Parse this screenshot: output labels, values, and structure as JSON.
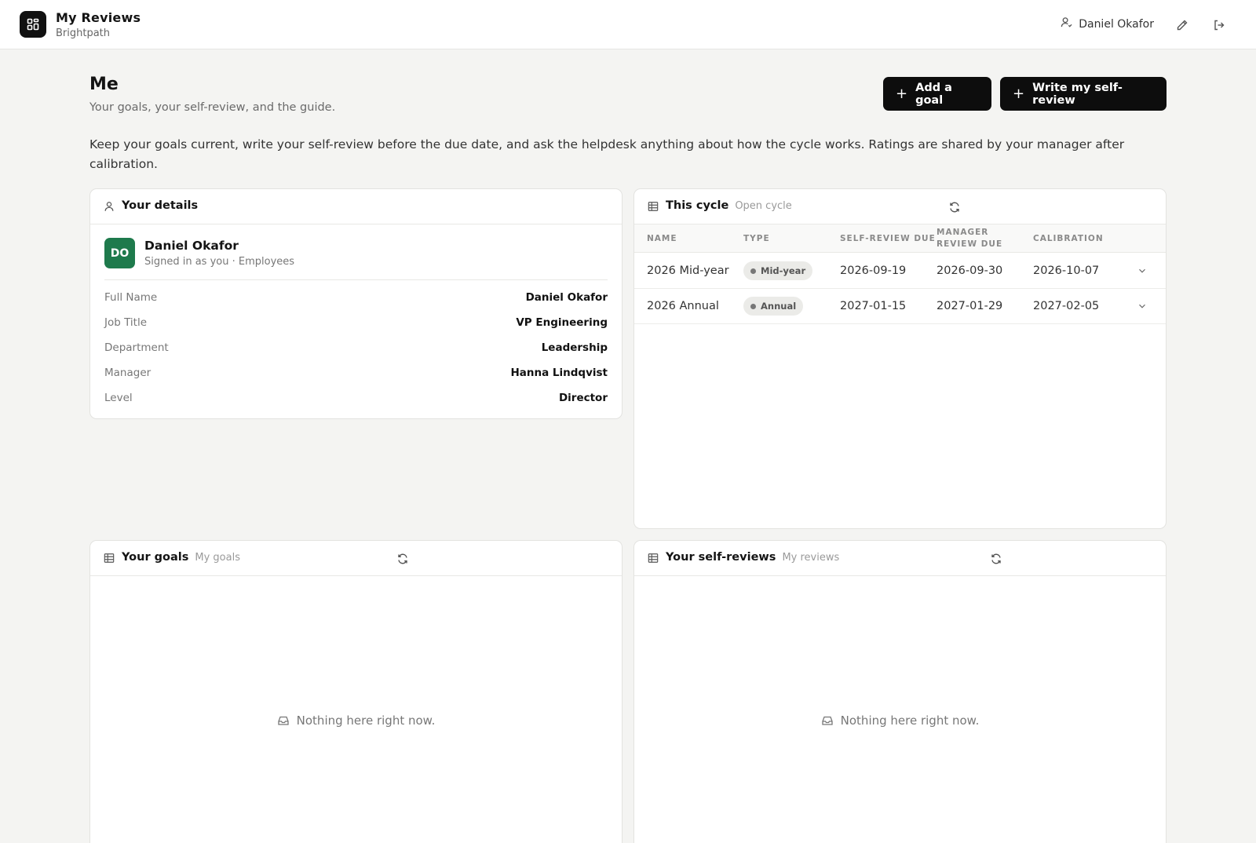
{
  "app": {
    "title": "My Reviews",
    "subtitle": "Brightpath"
  },
  "user": {
    "name": "Daniel Okafor"
  },
  "header": {
    "title": "Me",
    "subtitle": "Your goals, your self-review, and the guide.",
    "add_goal_label": "Add a goal",
    "self_review_label": "Write my self-review",
    "intro": "Keep your goals current, write your self-review before the due date, and ask the helpdesk anything about how the cycle works. Ratings are shared by your manager after calibration."
  },
  "details": {
    "title": "Your details",
    "initials": "DO",
    "name": "Daniel Okafor",
    "meta": "Signed in as you · Employees",
    "fields": [
      {
        "label": "Full Name",
        "value": "Daniel Okafor"
      },
      {
        "label": "Job Title",
        "value": "VP Engineering"
      },
      {
        "label": "Department",
        "value": "Leadership"
      },
      {
        "label": "Manager",
        "value": "Hanna Lindqvist"
      },
      {
        "label": "Level",
        "value": "Director"
      }
    ]
  },
  "cycle": {
    "title": "This cycle",
    "tag": "Open cycle",
    "columns": [
      "NAME",
      "TYPE",
      "SELF-REVIEW DUE",
      "MANAGER REVIEW DUE",
      "CALIBRATION"
    ],
    "rows": [
      {
        "name": "2026 Mid-year",
        "type": "Mid-year",
        "self_due": "2026-09-19",
        "manager_due": "2026-09-30",
        "calibration": "2026-10-07"
      },
      {
        "name": "2026 Annual",
        "type": "Annual",
        "self_due": "2027-01-15",
        "manager_due": "2027-01-29",
        "calibration": "2027-02-05"
      }
    ]
  },
  "goals": {
    "title": "Your goals",
    "tag": "My goals",
    "empty": "Nothing here right now."
  },
  "reviews": {
    "title": "Your self-reviews",
    "tag": "My reviews",
    "empty": "Nothing here right now."
  },
  "icons": {
    "logo": "grid-icon",
    "user": "user-icon",
    "edit": "pencil-icon",
    "logout": "logout-icon",
    "table": "table-icon",
    "refresh": "refresh-icon",
    "chevron": "chevron-down-icon",
    "inbox": "inbox-icon"
  },
  "colors": {
    "accent": "#0d0d0d",
    "avatar": "#1e7a4c",
    "background": "#f4f4f2"
  }
}
